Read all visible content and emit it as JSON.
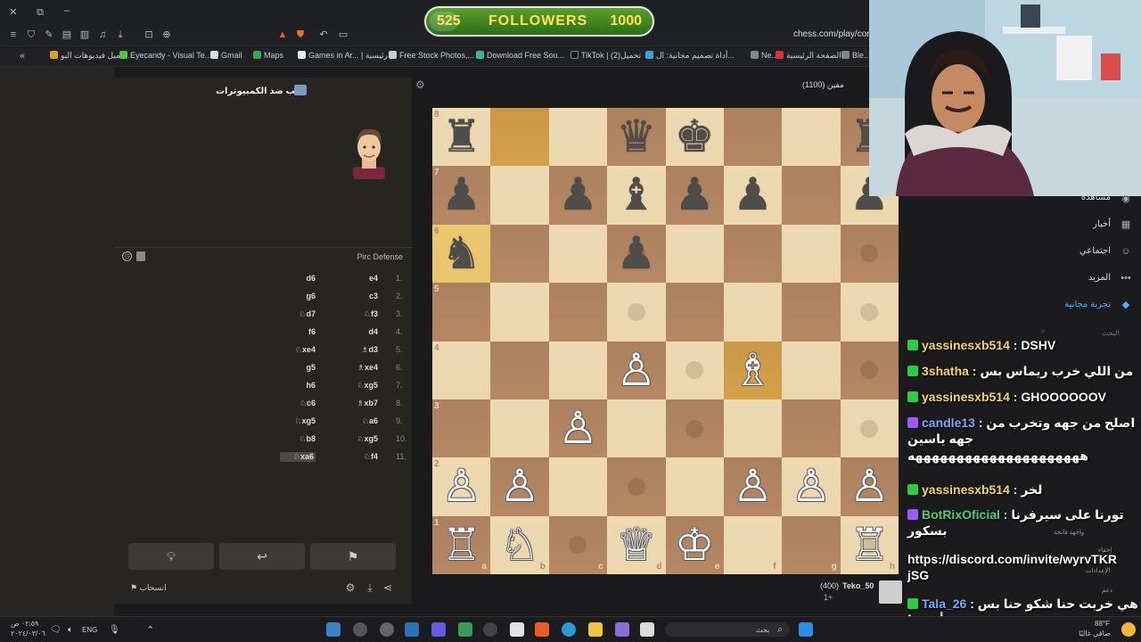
{
  "browser": {
    "url": "chess.com/play/com",
    "bookmarks": [
      "تحميل فيديوهات اليو...",
      "Eyecandy - Visual Te...",
      "Gmail",
      "Maps",
      "Games in Ar... | رئيسية",
      "Free Stock Photos,...",
      "Download Free Sou...",
      "TikTok | تحميل(2)",
      "أداة تصميم مجانية: ال...",
      "Ne...",
      "الصفحة الرئيسية -",
      "Ble..."
    ]
  },
  "overlay": {
    "followers_start": "525",
    "followers_label": "FOLLOWERS",
    "followers_goal": "1000",
    "followers_progress": 0.525
  },
  "panel": {
    "title": "العب ضد الكمبيوترات",
    "opening": "Pirc Defense",
    "moves": [
      {
        "num": "1.",
        "white": "e4",
        "black": "d6"
      },
      {
        "num": "2.",
        "white": "c3",
        "black": "g6"
      },
      {
        "num": "3.",
        "white": "♘f3",
        "black": "♘d7"
      },
      {
        "num": "4.",
        "white": "d4",
        "black": "f6"
      },
      {
        "num": "5.",
        "white": "♗d3",
        "black": "♘xe4"
      },
      {
        "num": "6.",
        "white": "♗xe4",
        "black": "g5"
      },
      {
        "num": "7.",
        "white": "♘xg5",
        "black": "h6"
      },
      {
        "num": "8.",
        "white": "♗xb7",
        "black": "♘c6"
      },
      {
        "num": "9.",
        "white": "♘a6",
        "black": "♘xg5"
      },
      {
        "num": "10.",
        "white": "♘xg5",
        "black": "♘b8"
      },
      {
        "num": "11.",
        "white": "♘f4",
        "black": "♘xa6"
      }
    ],
    "resign_label": "انسحاب"
  },
  "board": {
    "files": [
      "a",
      "b",
      "c",
      "d",
      "e",
      "f",
      "g",
      "h"
    ],
    "ranks": [
      "8",
      "7",
      "6",
      "5",
      "4",
      "3",
      "2",
      "1"
    ],
    "highlights": [
      "b8",
      "a6",
      "f4"
    ],
    "pieces": [
      {
        "sq": "a8",
        "p": "♜",
        "c": "b"
      },
      {
        "sq": "d8",
        "p": "♛",
        "c": "b"
      },
      {
        "sq": "e8",
        "p": "♚",
        "c": "b"
      },
      {
        "sq": "h8",
        "p": "♜",
        "c": "b"
      },
      {
        "sq": "a7",
        "p": "♟",
        "c": "b"
      },
      {
        "sq": "c7",
        "p": "♟",
        "c": "b"
      },
      {
        "sq": "d7",
        "p": "♝",
        "c": "b"
      },
      {
        "sq": "e7",
        "p": "♟",
        "c": "b"
      },
      {
        "sq": "f7",
        "p": "♟",
        "c": "b"
      },
      {
        "sq": "h7",
        "p": "♟",
        "c": "b"
      },
      {
        "sq": "a6",
        "p": "♞",
        "c": "b"
      },
      {
        "sq": "d6",
        "p": "♟",
        "c": "b"
      },
      {
        "sq": "d4",
        "p": "♙",
        "c": "w"
      },
      {
        "sq": "f4",
        "p": "♗",
        "c": "w"
      },
      {
        "sq": "c3",
        "p": "♙",
        "c": "w"
      },
      {
        "sq": "a2",
        "p": "♙",
        "c": "w"
      },
      {
        "sq": "b2",
        "p": "♙",
        "c": "w"
      },
      {
        "sq": "f2",
        "p": "♙",
        "c": "w"
      },
      {
        "sq": "g2",
        "p": "♙",
        "c": "w"
      },
      {
        "sq": "h2",
        "p": "♙",
        "c": "w"
      },
      {
        "sq": "a1",
        "p": "♖",
        "c": "w"
      },
      {
        "sq": "b1",
        "p": "♘",
        "c": "w"
      },
      {
        "sq": "d1",
        "p": "♕",
        "c": "w"
      },
      {
        "sq": "e1",
        "p": "♔",
        "c": "w"
      },
      {
        "sq": "h1",
        "p": "♖",
        "c": "w"
      }
    ],
    "hints": [
      "d6",
      "h6",
      "d5",
      "h5",
      "e4",
      "h4",
      "e3",
      "h3",
      "d2",
      "c1",
      "h1"
    ]
  },
  "players": {
    "top": "مفين (1100)",
    "bottom_name": "Teko_50",
    "bottom_rating": "(400)",
    "bottom_extra": "1+"
  },
  "right_nav": {
    "items": [
      "مشاهدة",
      "أخبار",
      "اجتماعي",
      "المزيد",
      "تجربة مجانية"
    ],
    "search_placeholder": "البحث",
    "side_hints": [
      "واجهة فاتحة",
      "إخفاء",
      "الإعدادات",
      "دعم"
    ]
  },
  "chat": [
    {
      "user": "yassinesxb514",
      "text": "DSHV",
      "color": "#f2d75a",
      "badge": "#2ecc40"
    },
    {
      "user": "3shatha",
      "text": "من اللي خرب ريماس بس",
      "color": "#f2d75a",
      "badge": "#2ecc40"
    },
    {
      "user": "yassinesxb514",
      "text": "GHOOOOOOV",
      "color": "#f2d75a",
      "badge": "#2ecc40"
    },
    {
      "user": "candle13",
      "text": "اصلح من جهه وتخرب من جهه ياسين",
      "color": "#7aa8ff",
      "badge": "#9b59ff"
    },
    {
      "user": "",
      "text": "هههههههههههههههههههههه",
      "color": "#fff",
      "badge": ""
    },
    {
      "user": "yassinesxb514",
      "text": "لخر",
      "color": "#f2d75a",
      "badge": "#2ecc40"
    },
    {
      "user": "BotRixOficial",
      "text": "تورنا على سيرفرنا بسكور",
      "color": "#47d17a",
      "badge": "#9b59ff"
    },
    {
      "user": "",
      "text": "https://discord.com/invite/wyrvTKR jSG",
      "color": "#fff",
      "badge": ""
    },
    {
      "user": "Tala_26",
      "text": "هي خربت حنا شكو حنا بس أختنها",
      "color": "#7aa8ff",
      "badge": "#2ecc40"
    }
  ],
  "taskbar": {
    "search": "بحث",
    "lang": "ENG",
    "time": "٠٢:٥٩ ص",
    "date": "٢٠٢٤/٠٣/٠٦",
    "weather": "88°F",
    "weather_desc": "صافي غالبًا"
  }
}
